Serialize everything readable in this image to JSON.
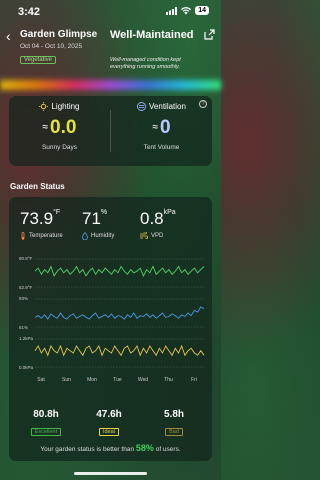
{
  "status_bar": {
    "time": "3:42",
    "battery": "14"
  },
  "header": {
    "title": "Garden Glimpse",
    "dates": "Oct 04 - Oct 10, 2025",
    "badge": "Vegetative",
    "status": "Well-Maintained",
    "description": "Well-managed condition kept everything running smoothly."
  },
  "environment": {
    "lighting": {
      "title": "Lighting",
      "value": "0.0",
      "approx": "≈",
      "label": "Sunny Days"
    },
    "ventilation": {
      "title": "Ventilation",
      "value": "0",
      "approx": "≈",
      "label": "Tent Volume"
    }
  },
  "garden_status": {
    "title": "Garden Status",
    "temperature": {
      "value": "73.9",
      "unit": "°F",
      "label": "Temperature"
    },
    "humidity": {
      "value": "71",
      "unit": "%",
      "label": "Humidity"
    },
    "vpd": {
      "value": "0.8",
      "unit": "kPa",
      "label": "VPD"
    }
  },
  "chart_data": {
    "type": "line",
    "x": [
      "Sat",
      "Sun",
      "Mon",
      "Tue",
      "Wed",
      "Thu",
      "Fri"
    ],
    "series": [
      {
        "name": "Temperature",
        "range": [
          62.9,
          80.8
        ],
        "color": "#4cd36b",
        "values": [
          73,
          75,
          71,
          74,
          72,
          76,
          70,
          73,
          75,
          72,
          74,
          71,
          73,
          76,
          72,
          74,
          70,
          73,
          75,
          71,
          74,
          72,
          75,
          73,
          71,
          74,
          72,
          76,
          73,
          71,
          74,
          72,
          73,
          75,
          70,
          74,
          72,
          76,
          71,
          73,
          75,
          72,
          74,
          71,
          73,
          76,
          72,
          74,
          71,
          73,
          75,
          72,
          74,
          76
        ]
      },
      {
        "name": "Humidity",
        "range": [
          61,
          93
        ],
        "color": "#4a9be8",
        "values": [
          72,
          74,
          71,
          75,
          70,
          76,
          73,
          71,
          77,
          72,
          70,
          74,
          76,
          71,
          73,
          75,
          72,
          70,
          74,
          77,
          71,
          73,
          75,
          72,
          76,
          71,
          74,
          73,
          70,
          75,
          72,
          77,
          71,
          74,
          73,
          76,
          72,
          75,
          71,
          74,
          77,
          72,
          73,
          76,
          74,
          71,
          75,
          73,
          77,
          74,
          80,
          78,
          84,
          82
        ]
      },
      {
        "name": "VPD",
        "range": [
          0,
          1.2
        ],
        "color": "#e8c84a",
        "values": [
          0.7,
          0.9,
          0.6,
          0.8,
          0.5,
          0.9,
          0.7,
          0.6,
          0.9,
          0.5,
          0.8,
          0.7,
          0.6,
          0.9,
          0.7,
          0.5,
          0.8,
          0.9,
          0.6,
          0.7,
          0.9,
          0.5,
          0.8,
          0.7,
          0.6,
          0.9,
          0.7,
          0.5,
          0.8,
          0.9,
          0.6,
          0.7,
          0.9,
          0.5,
          0.8,
          0.6,
          0.9,
          0.7,
          0.5,
          0.8,
          0.6,
          0.9,
          0.7,
          0.5,
          0.8,
          0.6,
          0.9,
          0.5,
          0.7,
          0.8,
          0.6,
          0.5,
          0.7,
          0.5
        ]
      }
    ],
    "tick_labels": {
      "temp_top": "80.8°F",
      "temp_bottom": "62.9°F",
      "hum_top": "93%",
      "hum_bottom": "61%",
      "vpd_top": "1.2kPa",
      "vpd_bottom": "0.0kPa"
    }
  },
  "stats": [
    {
      "value": "80.8h",
      "tag": "Excellent"
    },
    {
      "value": "47.6h",
      "tag": "Ideal"
    },
    {
      "value": "5.8h",
      "tag": "Bad"
    }
  ],
  "summary": {
    "prefix": "Your garden status is better than",
    "pct": "58%",
    "suffix": "of users."
  }
}
